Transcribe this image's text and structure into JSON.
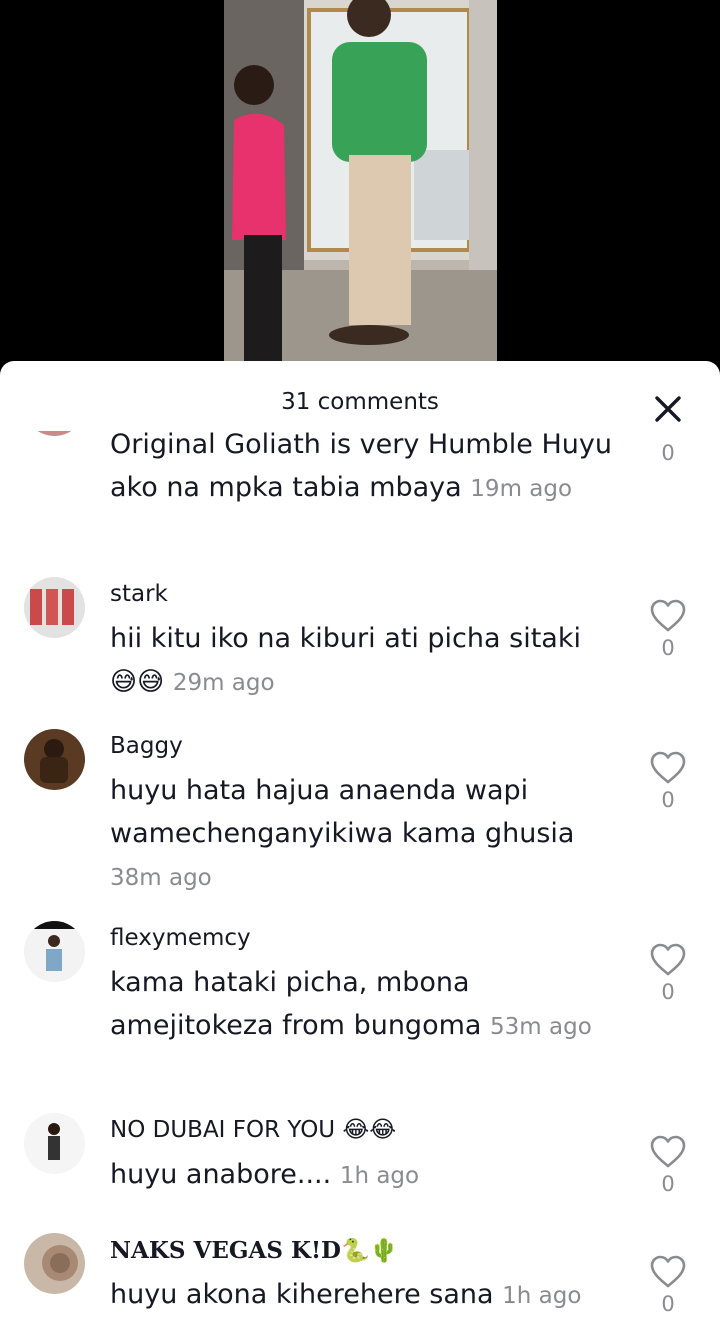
{
  "header": {
    "comment_count": "31 comments"
  },
  "comments": [
    {
      "user": "",
      "text": "Original Goliath is very Humble Huyu ako na mpka tabia mbaya",
      "time": "19m ago",
      "likes": "0"
    },
    {
      "user": "stark",
      "text": "hii kitu iko na kiburi ati picha sitaki",
      "emoji": "😅😅",
      "time": "29m ago",
      "likes": "0"
    },
    {
      "user": "Baggy",
      "text": "huyu hata hajua anaenda wapi wamechenganyikiwa kama ghusia",
      "time": "38m ago",
      "likes": "0"
    },
    {
      "user": "flexymemcy",
      "text": "kama hataki picha, mbona amejitokeza from bungoma",
      "time": "53m ago",
      "likes": "0"
    },
    {
      "user": "NO DUBAI FOR YOU 😂😂",
      "text": "huyu anabore....",
      "time": "1h ago",
      "likes": "0"
    },
    {
      "user": "NAKS VEGAS K!D🐍🌵",
      "text": "huyu akona kiherehere sana",
      "time": "1h ago",
      "likes": "0"
    }
  ],
  "icons": {
    "close": "close-icon",
    "like": "heart-outline-icon"
  },
  "colors": {
    "text": "#161823",
    "secondary": "#8a8b91",
    "sheet": "#ffffff"
  }
}
